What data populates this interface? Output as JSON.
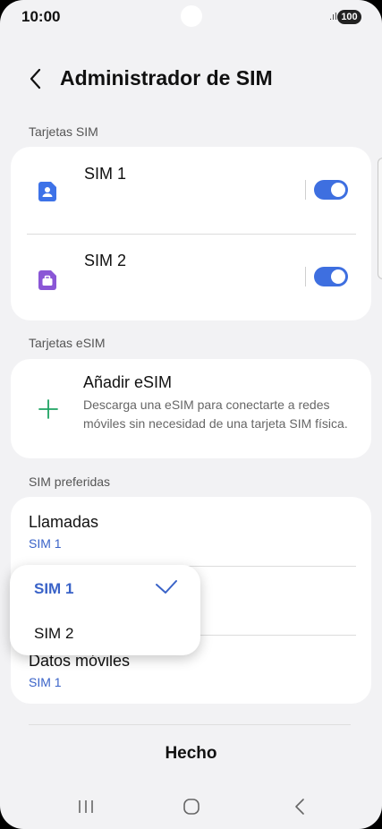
{
  "status": {
    "time": "10:00",
    "battery": "100"
  },
  "header": {
    "title": "Administrador de SIM"
  },
  "sections": {
    "sim_cards": "Tarjetas SIM",
    "esim_cards": "Tarjetas eSIM",
    "preferred": "SIM preferidas"
  },
  "sims": [
    {
      "name": "SIM 1",
      "enabled": true,
      "color": "#3d72e8"
    },
    {
      "name": "SIM 2",
      "enabled": true,
      "color": "#8a56d6"
    }
  ],
  "esim": {
    "title": "Añadir eSIM",
    "description": "Descarga una eSIM para conectarte a redes móviles sin necesidad de una tarjeta SIM física."
  },
  "preferred": {
    "calls": {
      "title": "Llamadas",
      "value": "SIM 1"
    },
    "data": {
      "title": "Datos móviles",
      "value": "SIM 1"
    }
  },
  "dropdown": {
    "options": [
      {
        "label": "SIM 1",
        "selected": true
      },
      {
        "label": "SIM 2",
        "selected": false
      }
    ]
  },
  "footer": {
    "done": "Hecho"
  },
  "colors": {
    "accent": "#3e6fe0",
    "selected_text": "#3a63c8",
    "plus": "#1fa463"
  }
}
